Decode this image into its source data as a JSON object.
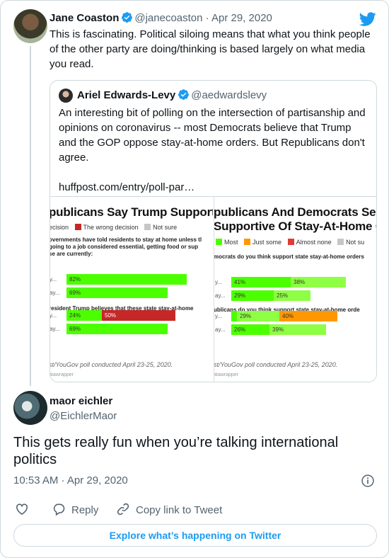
{
  "main_tweet": {
    "author_name": "Jane Coaston",
    "author_handle": "@janecoaston",
    "date_suffix": " · Apr 29, 2020",
    "text": "This is fascinating. Political siloing means that what you think people of the other party are doing/thinking is based largely on what media you read."
  },
  "quoted_tweet": {
    "author_name": "Ariel Edwards-Levy",
    "author_handle": "@aedwardslevy",
    "text": "An interesting bit of polling on the intersection of partisanship and opinions on coronavirus -- most Democrats believe that Trump and the GOP oppose stay-at-home orders. But Republicans don't agree.\n\nhuffpost.com/entry/poll-par…"
  },
  "image": {
    "left": {
      "title": "publicans Say Trump Support",
      "legend": [
        {
          "label": "ecision",
          "color": ""
        },
        {
          "label": "The wrong decision",
          "color": "#c62828"
        },
        {
          "label": "Not sure",
          "color": "#c6c6c6"
        }
      ],
      "question1": [
        "overnments have told residents to stay at home unless tl",
        "going to a job considered essential, getting food or sup",
        "se are currently:"
      ],
      "question2": "resident Trump believes that these state stay-at-home",
      "rows": [
        {
          "label": "y...",
          "segments": [
            {
              "value": "82%",
              "pct": 82,
              "color": "#4cff00"
            }
          ]
        },
        {
          "label": "ay...",
          "segments": [
            {
              "value": "69%",
              "pct": 69,
              "color": "#4cff00"
            }
          ]
        },
        {
          "label": "y...",
          "segments": [
            {
              "value": "24%",
              "pct": 24,
              "color": "#4cff00"
            },
            {
              "value": "50%",
              "pct": 50,
              "color": "#c62828"
            }
          ]
        },
        {
          "label": "ay...",
          "segments": [
            {
              "value": "69%",
              "pct": 69,
              "color": "#4cff00"
            }
          ]
        }
      ],
      "source": "st/YouGov poll conducted April 23-25, 2020.",
      "credit": "atawrapper"
    },
    "right": {
      "title_line1": "publicans And Democrats See",
      "title_line2": "Supportive Of Stay-At-Home O",
      "legend": [
        {
          "label": "Most",
          "color": "#4cff00"
        },
        {
          "label": "Just some",
          "color": "#ff9800"
        },
        {
          "label": "Almost none",
          "color": "#e53935"
        },
        {
          "label": "Not su",
          "color": "#c6c6c6"
        }
      ],
      "question1": "mocrats do you think support state stay-at-home orders",
      "question2": "ublicans do you think support state stay-at-home orde",
      "rows": [
        {
          "label": "y...",
          "segments": [
            {
              "value": "41%",
              "pct": 41,
              "color": "#4cff00"
            },
            {
              "value": "38%",
              "pct": 38,
              "color": "#8eff44"
            }
          ]
        },
        {
          "label": "ay...",
          "segments": [
            {
              "value": "29%",
              "pct": 29,
              "color": "#4cff00"
            },
            {
              "value": "25%",
              "pct": 25,
              "color": "#8eff44"
            }
          ]
        },
        {
          "label": "y...",
          "segments": [
            {
              "value": "",
              "pct": 4,
              "color": "#4cff00"
            },
            {
              "value": "29%",
              "pct": 29,
              "color": "#8eff44"
            },
            {
              "value": "40%",
              "pct": 40,
              "color": "#ff9800"
            }
          ]
        },
        {
          "label": "ay...",
          "segments": [
            {
              "value": "26%",
              "pct": 26,
              "color": "#4cff00"
            },
            {
              "value": "39%",
              "pct": 39,
              "color": "#8eff44"
            }
          ]
        }
      ],
      "source": "st/YouGov poll conducted April 23-25, 2020.",
      "credit": "atawrapper"
    }
  },
  "reply_tweet": {
    "author_name": "maor eichler",
    "author_handle": "@EichlerMaor",
    "text": "This gets really fun when you’re talking international politics",
    "timestamp": "10:53 AM · Apr 29, 2020"
  },
  "actions": {
    "like_icon": "heart-icon",
    "reply_label": "Reply",
    "copy_label": "Copy link to Tweet"
  },
  "explore_label": "Explore what’s happening on Twitter",
  "colors": {
    "twitter_blue": "#1d9bf0",
    "verified": "#1d9bf0",
    "border": "#cfd9de",
    "secondary_text": "#536471"
  }
}
